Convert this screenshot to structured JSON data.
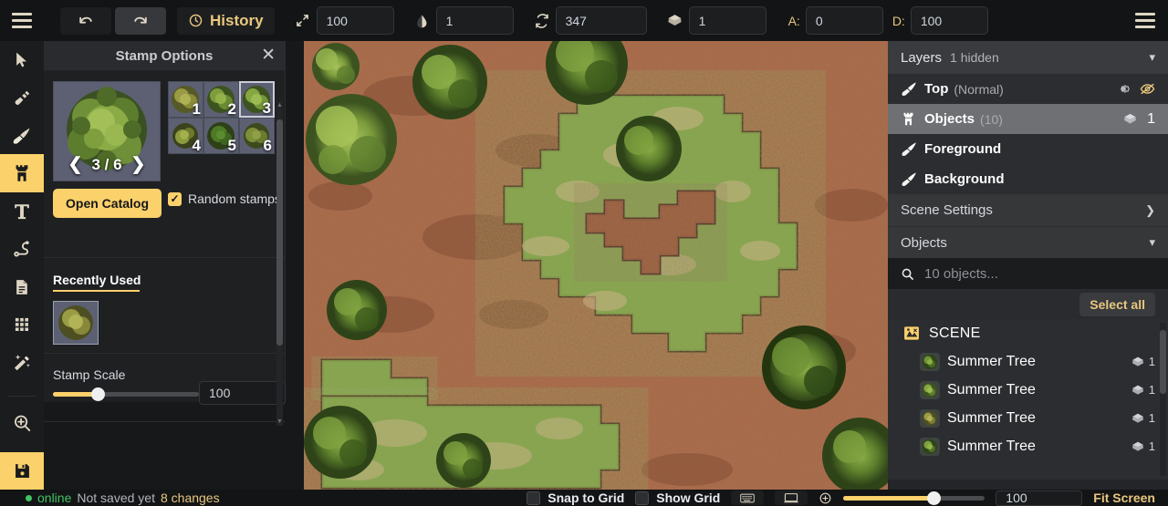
{
  "topbar": {
    "menu_icon": "hamburger-icon",
    "undo_label": "undo-icon",
    "redo_label": "redo-icon",
    "history_label": "History",
    "fields": [
      {
        "icon": "resize-arrows-icon",
        "value": "100"
      },
      {
        "icon": "opacity-drop-icon",
        "value": "1"
      },
      {
        "icon": "rotate-refresh-icon",
        "value": "347"
      },
      {
        "icon": "layers-diamond-icon",
        "value": "1"
      }
    ],
    "a_label": "A:",
    "a_value": "0",
    "d_label": "D:",
    "d_value": "100",
    "overflow_icon": "hamburger-icon"
  },
  "toolbar": {
    "tools": [
      {
        "name": "select-tool",
        "icon": "cursor-arrow-icon",
        "selected": false
      },
      {
        "name": "dig-tool",
        "icon": "shovel-icon",
        "selected": false
      },
      {
        "name": "paint-tool",
        "icon": "paintbrush-icon",
        "selected": false
      },
      {
        "name": "stamp-tool",
        "icon": "castle-tower-icon",
        "selected": true
      },
      {
        "name": "text-tool",
        "icon": "text-t-icon",
        "selected": false
      },
      {
        "name": "path-tool",
        "icon": "route-path-icon",
        "selected": false
      },
      {
        "name": "notes-tool",
        "icon": "document-icon",
        "selected": false
      },
      {
        "name": "grid-tool",
        "icon": "grid-dots-icon",
        "selected": false
      },
      {
        "name": "magic-tool",
        "icon": "magic-wand-icon",
        "selected": false
      }
    ],
    "bottom_tools": [
      {
        "name": "zoom-tool",
        "icon": "magnifier-plus-icon",
        "selected": false
      },
      {
        "name": "save-tool",
        "icon": "floppy-disk-icon",
        "selected": true
      }
    ]
  },
  "stamp_panel": {
    "title": "Stamp Options",
    "close_icon": "close-x-icon",
    "preview_counter": "3 / 6",
    "prev_icon": "chevron-left-icon",
    "next_icon": "chevron-right-icon",
    "thumbnails": [
      {
        "label": "1",
        "selected": false
      },
      {
        "label": "2",
        "selected": false
      },
      {
        "label": "3",
        "selected": true
      },
      {
        "label": "4",
        "selected": false
      },
      {
        "label": "5",
        "selected": false
      },
      {
        "label": "6",
        "selected": false
      }
    ],
    "open_catalog_label": "Open Catalog",
    "random_stamps_label": "Random stamps",
    "random_stamps_checked": true,
    "recently_used_label": "Recently Used",
    "stamp_scale_label": "Stamp Scale",
    "stamp_scale_value": "100"
  },
  "right_panel": {
    "layers_title": "Layers",
    "layers_subtitle": "1 hidden",
    "layers_collapse_icon": "chevron-down-icon",
    "layers": [
      {
        "name": "Top",
        "mode": "(Normal)",
        "icon": "paintbrush-icon",
        "selected": false,
        "gear_icon": "gear-icon",
        "hidden_icon": "eye-off-icon",
        "count": ""
      },
      {
        "name": "Objects",
        "mode": "(10)",
        "icon": "castle-tower-icon",
        "selected": true,
        "gear_icon": "",
        "hidden_icon": "",
        "count": "1"
      },
      {
        "name": "Foreground",
        "mode": "",
        "icon": "paintbrush-icon",
        "selected": false,
        "gear_icon": "",
        "hidden_icon": "",
        "count": ""
      },
      {
        "name": "Background",
        "mode": "",
        "icon": "paintbrush-icon",
        "selected": false,
        "gear_icon": "",
        "hidden_icon": "",
        "count": ""
      }
    ],
    "scene_settings_label": "Scene Settings",
    "scene_settings_icon": "chevron-right-icon",
    "objects_label": "Objects",
    "objects_collapse_icon": "chevron-down-icon",
    "search_icon": "search-icon",
    "search_placeholder": "10 objects...",
    "select_all_label": "Select all",
    "objects_tree": [
      {
        "name": "SCENE",
        "icon": "scene-icon",
        "count": "",
        "indent": 0
      },
      {
        "name": "Summer Tree",
        "icon": "tree-icon",
        "count": "1",
        "indent": 1
      },
      {
        "name": "Summer Tree",
        "icon": "tree-icon",
        "count": "1",
        "indent": 1
      },
      {
        "name": "Summer Tree",
        "icon": "tree-icon",
        "count": "1",
        "indent": 1
      },
      {
        "name": "Summer Tree",
        "icon": "tree-icon",
        "count": "1",
        "indent": 1
      }
    ]
  },
  "statusbar": {
    "online_label": "online",
    "saved_label": "Not saved yet",
    "changes_label": "8 changes",
    "snap_to_grid_label": "Snap to Grid",
    "snap_to_grid_checked": false,
    "show_grid_label": "Show Grid",
    "show_grid_checked": false,
    "keyboard_icon": "keyboard-icon",
    "screen_icon": "monitor-icon",
    "zoom_icon": "zoom-circle-icon",
    "zoom_value": "100",
    "fit_screen_label": "Fit Screen"
  },
  "colors": {
    "accent": "#fbd16b",
    "accent_text": "#e8c87e",
    "panel_bg": "#1f2022",
    "online": "#3fc463",
    "terrain_dirt": "#a8653f",
    "terrain_grass": "#7f9a46"
  }
}
